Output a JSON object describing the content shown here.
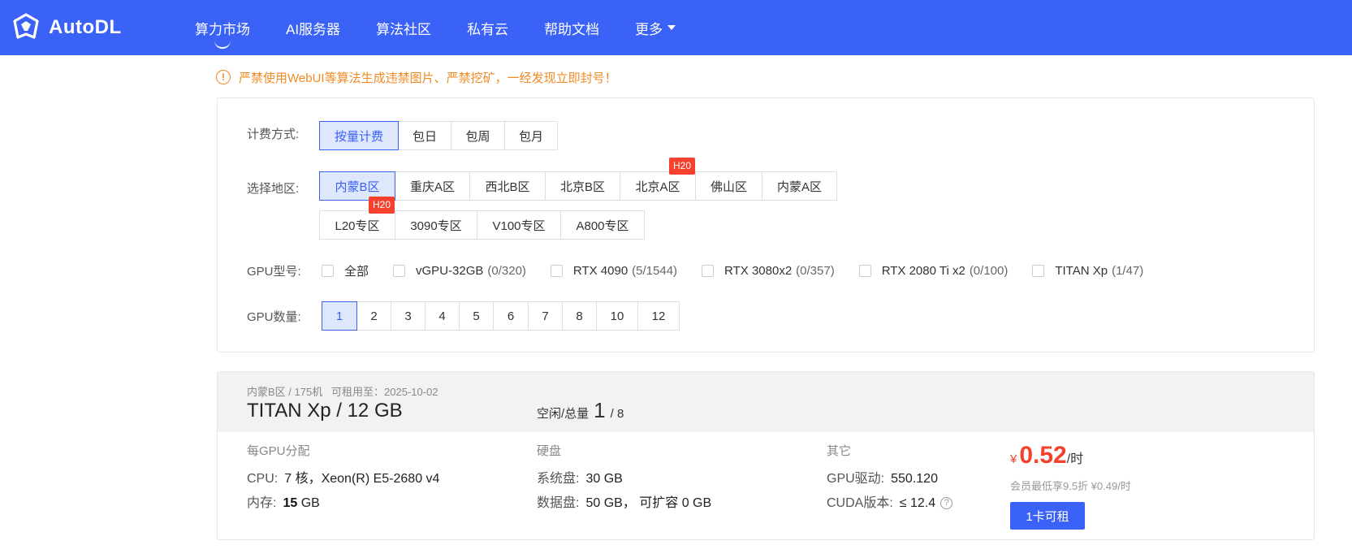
{
  "header": {
    "brand": "AutoDL",
    "nav": [
      {
        "label": "算力市场",
        "active": true
      },
      {
        "label": "AI服务器"
      },
      {
        "label": "算法社区"
      },
      {
        "label": "私有云"
      },
      {
        "label": "帮助文档"
      },
      {
        "label": "更多"
      }
    ]
  },
  "warning": {
    "text": "严禁使用WebUI等算法生成违禁图片、严禁挖矿，一经发现立即封号！",
    "icon": "!"
  },
  "filters": {
    "billing": {
      "label": "计费方式:",
      "options": [
        "按量计费",
        "包日",
        "包周",
        "包月"
      ],
      "selected": "按量计费"
    },
    "region": {
      "label": "选择地区:",
      "row1": [
        "内蒙B区",
        "重庆A区",
        "西北B区",
        "北京B区",
        "北京A区",
        "佛山区",
        "内蒙A区"
      ],
      "row2": [
        "L20专区",
        "3090专区",
        "V100专区",
        "A800专区"
      ],
      "selected": "内蒙B区",
      "badge": "H20"
    },
    "gpu_model": {
      "label": "GPU型号:",
      "options": [
        {
          "name": "全部",
          "count": ""
        },
        {
          "name": "vGPU-32GB",
          "count": "(0/320)"
        },
        {
          "name": "RTX 4090",
          "count": "(5/1544)"
        },
        {
          "name": "RTX 3080x2",
          "count": "(0/357)"
        },
        {
          "name": "RTX 2080 Ti x2",
          "count": "(0/100)"
        },
        {
          "name": "TITAN Xp",
          "count": "(1/47)"
        }
      ]
    },
    "gpu_count": {
      "label": "GPU数量:",
      "options": [
        "1",
        "2",
        "3",
        "4",
        "5",
        "6",
        "7",
        "8",
        "10",
        "12"
      ],
      "selected": "1"
    }
  },
  "card": {
    "meta": "内蒙B区 / 175机   可租用至：2025-10-02",
    "title": "TITAN Xp / 12 GB",
    "idle_label": "空闲/总量",
    "idle_value": "1",
    "idle_total": "/ 8",
    "col1": {
      "header": "每GPU分配",
      "cpu_label": "CPU:",
      "cpu_value": "7 核，Xeon(R) E5-2680 v4",
      "mem_label": "内存:",
      "mem_num": "15",
      "mem_unit": " GB"
    },
    "col2": {
      "header": "硬盘",
      "sys_label": "系统盘:",
      "sys_value": "30 GB",
      "data_label": "数据盘:",
      "data_value": "50 GB， 可扩容 0 GB"
    },
    "col3": {
      "header": "其它",
      "driver_label": "GPU驱动:",
      "driver_value": "550.120",
      "cuda_label": "CUDA版本:",
      "cuda_value": "≤ 12.4",
      "help": "?"
    },
    "price": {
      "currency": "¥",
      "value": "0.52",
      "unit": "/时"
    },
    "member_text": "会员最低享9.5折 ¥0.49/时",
    "rent_button": "1卡可租"
  },
  "colors": {
    "primary": "#3b62f6",
    "warning": "#f08a24",
    "price": "#f5412d"
  }
}
